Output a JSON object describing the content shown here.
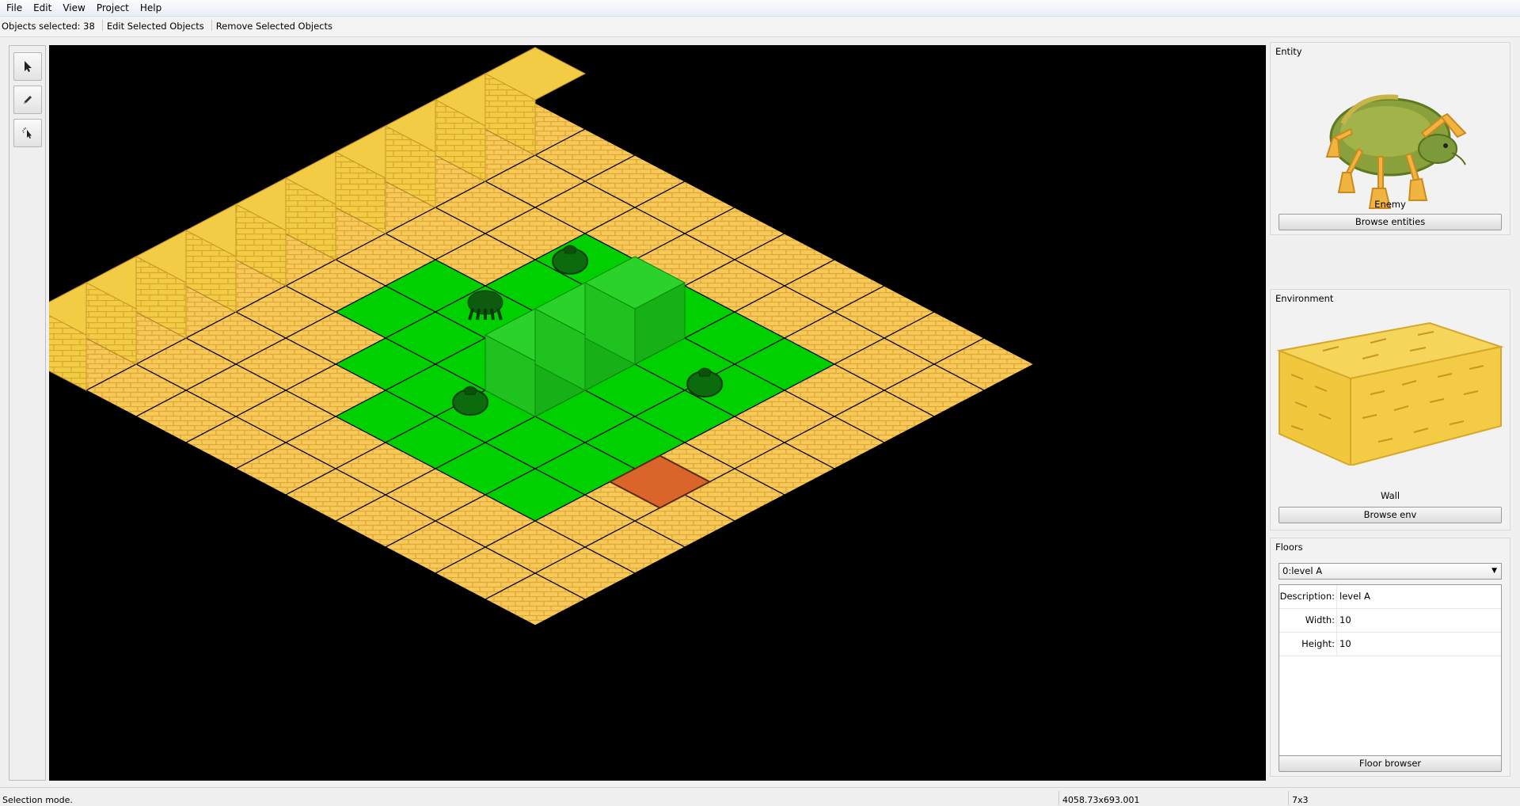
{
  "menu": [
    "File",
    "Edit",
    "View",
    "Project",
    "Help"
  ],
  "toolbar": {
    "selected_label": "Objects selected: 38",
    "edit_label": "Edit Selected Objects",
    "remove_label": "Remove Selected Objects"
  },
  "tools": [
    {
      "name": "select-tool",
      "icon": "arrow-pointer-icon"
    },
    {
      "name": "draw-tool",
      "icon": "pencil-icon"
    },
    {
      "name": "multi-select-tool",
      "icon": "cursor-sparkle-icon"
    }
  ],
  "entity": {
    "title": "Entity",
    "selected_name": "Enemy",
    "button": "Browse entities"
  },
  "environment": {
    "title": "Environment",
    "selected_name": "Wall",
    "button": "Browse env"
  },
  "floors": {
    "title": "Floors",
    "selected": "0:level A",
    "properties": [
      {
        "key": "Description:",
        "value": "level A"
      },
      {
        "key": "Width:",
        "value": "10"
      },
      {
        "key": "Height:",
        "value": "10"
      }
    ],
    "button": "Floor browser"
  },
  "status": {
    "mode": "Selection mode.",
    "coords": "4058.73x693.001",
    "tile": "7x3"
  },
  "map": {
    "grid_size": 10,
    "colors": {
      "floor": "#f7c95a",
      "grout": "#e0a732",
      "selection": "#00d000",
      "wall": "#f2cc45",
      "hole": "#d9652a",
      "background": "#000000"
    }
  }
}
